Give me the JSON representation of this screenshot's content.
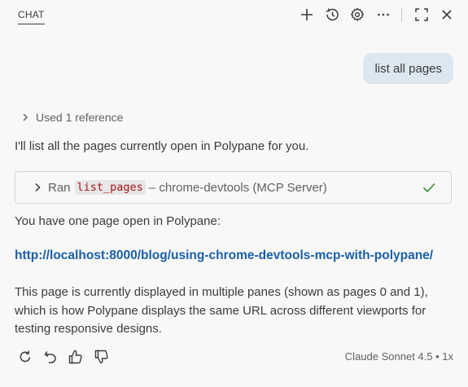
{
  "header": {
    "tab_label": "CHAT",
    "icons": [
      "plus-icon",
      "history-icon",
      "gear-icon",
      "more-icon",
      "maximize-icon",
      "close-icon"
    ]
  },
  "user_message": "list all pages",
  "references": {
    "label": "Used 1 reference"
  },
  "assistant": {
    "intro": "I'll list all the pages currently open in Polypane for you.",
    "tool_call": {
      "prefix": "Ran",
      "tool_name": "list_pages",
      "suffix": "– chrome-devtools (MCP Server)",
      "status": "success"
    },
    "summary": "You have one page open in Polypane:",
    "link": "http://localhost:8000/blog/using-chrome-devtools-mcp-with-polypane/",
    "paragraph": "This page is currently displayed in multiple panes (shown as pages 0 and 1), which is how Polypane displays the same URL across different viewports for testing responsive designs."
  },
  "footer": {
    "actions": [
      "retry-icon",
      "undo-icon",
      "thumbs-up-icon",
      "thumbs-down-icon"
    ],
    "model_label": "Claude Sonnet 4.5 • 1x"
  },
  "colors": {
    "accent_link": "#1a5fa8",
    "user_bubble": "#dde7f0",
    "success": "#388a34",
    "code_text": "#a31515"
  }
}
